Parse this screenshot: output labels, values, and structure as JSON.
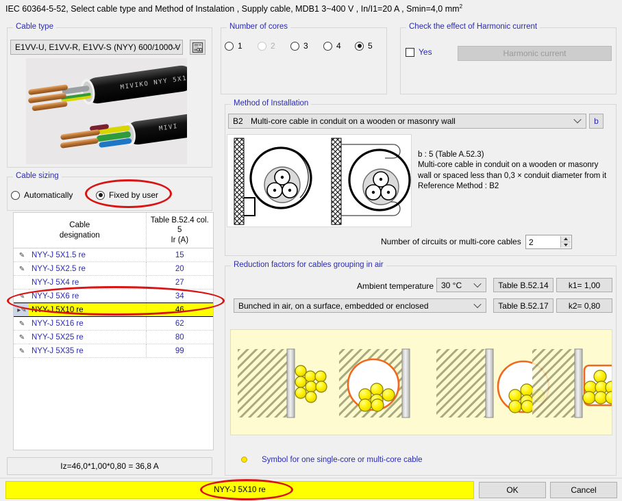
{
  "header": {
    "title_prefix": "IEC 60364-5-52, Select cable type and Method of Instalation , Supply cable, MDB1 3~400 V , In/I1=20 A , Smin=4,0 mm",
    "title_sup": "2"
  },
  "cable_type": {
    "legend": "Cable type",
    "selected": "E1VV-U, E1VV-R, E1VV-S  (NYY)  600/1000 V",
    "catalog_icon": "database-icon"
  },
  "number_of_cores": {
    "legend": "Number of cores",
    "options": [
      {
        "label": "1",
        "checked": false,
        "disabled": false
      },
      {
        "label": "2",
        "checked": false,
        "disabled": true
      },
      {
        "label": "3",
        "checked": false,
        "disabled": false
      },
      {
        "label": "4",
        "checked": false,
        "disabled": false
      },
      {
        "label": "5",
        "checked": true,
        "disabled": false
      }
    ]
  },
  "harmonic": {
    "legend": "Check the effect of Harmonic current",
    "checkbox_label": "Yes",
    "checked": false,
    "button_label": "Harmonic current",
    "button_enabled": false
  },
  "method_of_installation": {
    "legend": "Method of Installation",
    "code": "B2",
    "description": "Multi-core cable in conduit on a wooden or masonry wall",
    "side_button": "b",
    "detail_lines": [
      "b : 5 (Table A.52.3)",
      "Multi-core cable in conduit on a wooden or masonry wall or spaced less than 0,3 × conduit diameter from it",
      "Reference Method : B2"
    ],
    "circuits_label": "Number of circuits or multi-core cables",
    "circuits_value": "2"
  },
  "cable_sizing": {
    "legend": "Cable sizing",
    "mode_options": [
      {
        "label": "Automatically",
        "checked": false
      },
      {
        "label": "Fixed by user",
        "checked": true
      }
    ],
    "table": {
      "headers": [
        "Cable\ndesignation",
        "Table B.52.4 col. 5\nIr (A)"
      ],
      "header_col1_line1": "Cable",
      "header_col1_line2": "designation",
      "header_col2_line1": "Table B.52.4 col. 5",
      "header_col2_line2": "Ir (A)",
      "rows": [
        {
          "designation": "NYY-J 5X1.5 re",
          "ir": "15",
          "selected": false,
          "pen": true
        },
        {
          "designation": "NYY-J 5X2.5 re",
          "ir": "20",
          "selected": false,
          "pen": true
        },
        {
          "designation": "NYY-J 5X4 re",
          "ir": "27",
          "selected": false,
          "pen": false
        },
        {
          "designation": "NYY-J 5X6 re",
          "ir": "34",
          "selected": false,
          "pen": true
        },
        {
          "designation": "NYY-J 5X10 re",
          "ir": "46",
          "selected": true,
          "pen": true
        },
        {
          "designation": "NYY-J 5X16 re",
          "ir": "62",
          "selected": false,
          "pen": true
        },
        {
          "designation": "NYY-J 5X25 re",
          "ir": "80",
          "selected": false,
          "pen": true
        },
        {
          "designation": "NYY-J 5X35 re",
          "ir": "99",
          "selected": false,
          "pen": true
        }
      ]
    },
    "iz_result": "Iz=46,0*1,00*0,80 =  36,8 A"
  },
  "reduction_factors": {
    "legend": "Reduction factors for cables grouping in air",
    "ambient_label": "Ambient temperature",
    "ambient_value": "30 °C",
    "table1_label": "Table B.52.14",
    "k1_label": "k1= 1,00",
    "grouping_value": "Bunched in air, on a surface, embedded or enclosed",
    "table2_label": "Table B.52.17",
    "k2_label": "k2= 0,80",
    "legend_symbol_text": "Symbol for one single-core or multi-core cable"
  },
  "footer": {
    "result_value": "NYY-J 5X10 re",
    "ok_label": "OK",
    "cancel_label": "Cancel"
  },
  "colors": {
    "legend_blue": "#2a2ab0",
    "highlight_yellow": "#ffff00",
    "annotation_red": "#d81515",
    "panel_yellow": "#fdfbcf"
  }
}
